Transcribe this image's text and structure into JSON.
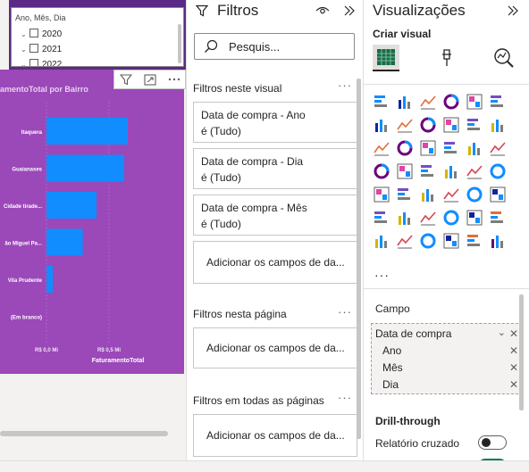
{
  "slicer": {
    "header": "Ano, Mês, Dia",
    "items": [
      {
        "chevron": "⌄",
        "label": "2020"
      },
      {
        "chevron": "⌄",
        "label": "2021"
      },
      {
        "chevron": "⌄",
        "label": "2022"
      }
    ]
  },
  "chart": {
    "title": "amentoTotal por Bairro"
  },
  "chart_data": {
    "type": "bar",
    "orientation": "horizontal",
    "title": "amentoTotal por Bairro",
    "xlabel": "FaturamentoTotal",
    "ylabel": "",
    "categories": [
      "Itaquera",
      "Guaianases",
      "Cidade tirade...",
      "ão Miguel Pa...",
      "Vila Prudente",
      "(Em branco)"
    ],
    "values": [
      0.65,
      0.62,
      0.4,
      0.29,
      0.05,
      0.0
    ],
    "xlim": [
      0,
      1.0
    ],
    "xticks": [
      "R$ 0,0 Mi",
      "R$ 0,5 Mi"
    ],
    "bar_color": "#118dff",
    "background": "#9b48b9",
    "grid": true
  },
  "filters": {
    "title": "Filtros",
    "search_placeholder": "Pesquis...",
    "section_visual": "Filtros neste visual",
    "cards": [
      {
        "line1": "Data de compra - Ano",
        "line2": "é (Tudo)"
      },
      {
        "line1": "Data de compra - Dia",
        "line2": "é (Tudo)"
      },
      {
        "line1": "Data de compra - Mês",
        "line2": "é (Tudo)"
      }
    ],
    "add_fields": "Adicionar os campos de da...",
    "section_page": "Filtros nesta página",
    "section_all": "Filtros em todas as páginas",
    "more": "···"
  },
  "viz": {
    "title": "Visualizações",
    "subtitle": "Criar visual",
    "more": "···",
    "campo_label": "Campo",
    "field": {
      "name": "Data de compra",
      "children": [
        "Ano",
        "Mês",
        "Dia"
      ]
    },
    "drill_label": "Drill-through",
    "cross_report_label": "Relatório cruzado"
  },
  "colors": {
    "accent_bar": "#118dff",
    "chart_background": "#9b48b9",
    "slicer_header_background": "#5b2a86",
    "toggle_on": "#117865"
  }
}
